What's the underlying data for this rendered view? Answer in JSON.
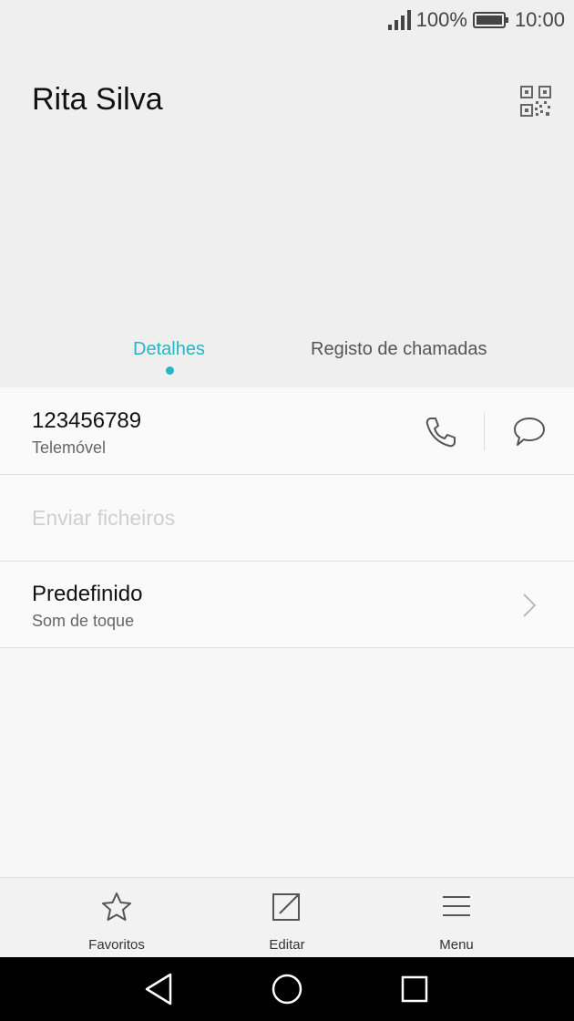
{
  "status_bar": {
    "battery": "100%",
    "time": "10:00",
    "icons": [
      "signal-icon",
      "battery-icon"
    ]
  },
  "header": {
    "contact_name": "Rita Silva",
    "qr_icon": "qr-code-icon"
  },
  "tabs": [
    {
      "label": "Detalhes",
      "active": true
    },
    {
      "label": "Registo de chamadas",
      "active": false
    }
  ],
  "phone": {
    "number": "123456789",
    "type": "Telemóvel",
    "icons": [
      "phone-icon",
      "message-icon"
    ]
  },
  "send_files": {
    "label": "Enviar ficheiros",
    "enabled": false
  },
  "ringtone": {
    "value": "Predefinido",
    "label": "Som de toque",
    "icon": "chevron-right-icon"
  },
  "bottom_bar": {
    "items": [
      {
        "label": "Favoritos",
        "icon": "star-icon"
      },
      {
        "label": "Editar",
        "icon": "edit-icon"
      },
      {
        "label": "Menu",
        "icon": "menu-icon"
      }
    ]
  },
  "nav_bar": {
    "icons": [
      "back-icon",
      "home-icon",
      "recents-icon"
    ]
  },
  "colors": {
    "accent": "#27b6c7",
    "header_bg": "#efefef",
    "body_bg": "#fafafa"
  }
}
